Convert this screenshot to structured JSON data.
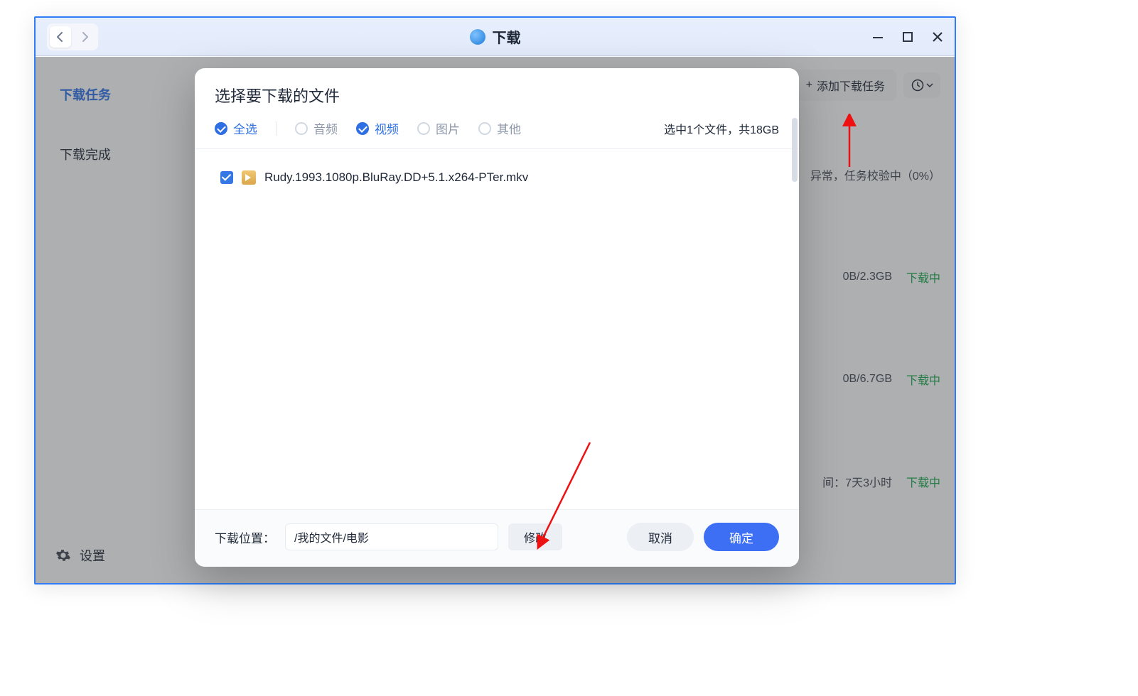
{
  "titlebar": {
    "title": "下载"
  },
  "sidebar": {
    "active": "下载任务",
    "completed": "下载完成",
    "settings": "设置"
  },
  "actions": {
    "add_task": "添加下载任务"
  },
  "rows": [
    {
      "meta": "异常，任务校验中（0%）",
      "status": ""
    },
    {
      "meta": "0B/2.3GB",
      "status": "下载中"
    },
    {
      "meta": "0B/6.7GB",
      "status": "下载中"
    },
    {
      "meta": "间：7天3小时",
      "status": "下载中"
    }
  ],
  "modal": {
    "title": "选择要下载的文件",
    "filters": {
      "all": "全选",
      "audio": "音频",
      "video": "视频",
      "image": "图片",
      "other": "其他"
    },
    "summary": "选中1个文件，共18GB",
    "file_name": "Rudy.1993.1080p.BluRay.DD+5.1.x264-PTer.mkv",
    "path_label": "下载位置：",
    "path_value": "/我的文件/电影",
    "modify": "修改",
    "cancel": "取消",
    "ok": "确定"
  }
}
